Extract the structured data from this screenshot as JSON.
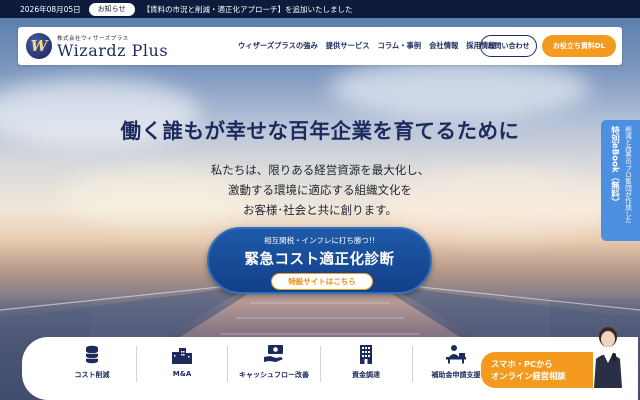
{
  "news": {
    "date": "2026年08月05日",
    "badge": "お知らせ",
    "text": "【賃料の市況と削減・適正化アプローチ】を追加いたしました"
  },
  "header": {
    "logo_mark": "W",
    "logo_sub": "株式会社ウィザーズプラス",
    "logo_name": "Wizardz Plus",
    "nav": [
      "ウィザーズプラスの強み",
      "提供サービス",
      "コラム・事例",
      "会社情報",
      "採用情報"
    ],
    "contact_label": "お問い合わせ",
    "download_label": "お役立ち資料DL"
  },
  "hero": {
    "catch": "働く誰もが幸せな百年企業を育てるために",
    "lead": [
      "私たちは、限りある経営資源を最大化し、",
      "激動する環境に適応する組織文化を",
      "お客様･社会と共に創ります。"
    ]
  },
  "campaign": {
    "small": "相互関税・インフレに打ち勝つ!!",
    "big": "緊急コスト適正化診断",
    "link": "特設サイトはこちら"
  },
  "sidetab": {
    "line1": "削減と改善のプロ集団が作成した",
    "line2": "特別eBook（無料）"
  },
  "services": [
    {
      "label": "コスト削減",
      "icon": "coin-stack-icon"
    },
    {
      "label": "M&A",
      "icon": "buildings-icon"
    },
    {
      "label": "キャッシュフロー改善",
      "icon": "cash-hand-icon"
    },
    {
      "label": "資金調達",
      "icon": "office-building-icon"
    },
    {
      "label": "補助金申請支援",
      "icon": "person-desk-icon"
    }
  ],
  "online": {
    "line1": "スマホ・PCから",
    "line2": "オンライン経営相談"
  },
  "colors": {
    "navy": "#1d2a5c",
    "orange": "#f49a1e",
    "blue": "#4d8fe0",
    "campaign_blue": "#1f5aa8"
  }
}
